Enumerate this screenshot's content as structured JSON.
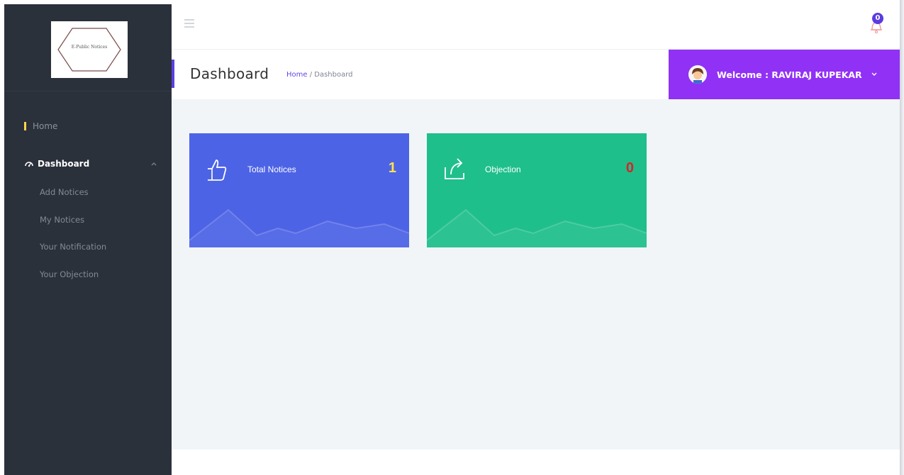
{
  "app": {
    "logo_text": "E-Public Notices"
  },
  "sidebar": {
    "home_label": "Home",
    "dashboard_label": "Dashboard",
    "submenu": [
      {
        "label": "Add Notices"
      },
      {
        "label": "My Notices"
      },
      {
        "label": "Your Notification"
      },
      {
        "label": "Your Objection"
      }
    ]
  },
  "topbar": {
    "notification_count": "0"
  },
  "header": {
    "title": "Dashboard",
    "breadcrumb_home": "Home",
    "breadcrumb_sep": " / ",
    "breadcrumb_current": "Dashboard",
    "welcome_text": "Welcome : RAVIRAJ KUPEKAR"
  },
  "cards": [
    {
      "title": "Total Notices",
      "value": "1",
      "icon": "thumbs-up-icon",
      "value_color": "#ffe14a",
      "bg": "#4d63e6"
    },
    {
      "title": "Objection",
      "value": "0",
      "icon": "share-icon",
      "value_color": "#d3262c",
      "bg": "#1fbf8b"
    }
  ],
  "colors": {
    "sidebar_bg": "#2b313b",
    "accent_purple": "#9131f5",
    "content_bg": "#f1f5f8"
  }
}
